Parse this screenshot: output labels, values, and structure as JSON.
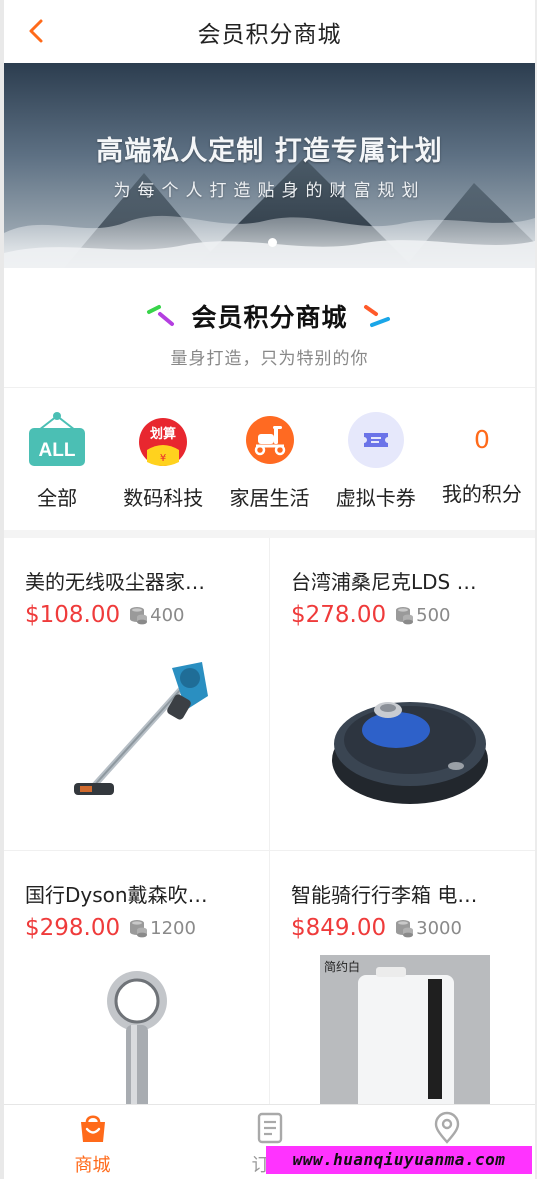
{
  "header": {
    "title": "会员积分商城"
  },
  "banner": {
    "title": "高端私人定制 打造专属计划",
    "subtitle": "为每个人打造贴身的财富规划"
  },
  "section": {
    "title": "会员积分商城",
    "subtitle": "量身打造，只为特别的你"
  },
  "categories": [
    {
      "label": "全部",
      "icon": "all-icon",
      "badge": "ALL"
    },
    {
      "label": "数码科技",
      "icon": "deal-icon",
      "badge": "划算"
    },
    {
      "label": "家居生活",
      "icon": "scooter-icon"
    },
    {
      "label": "虚拟卡券",
      "icon": "ticket-icon"
    },
    {
      "label": "我的积分",
      "value": "0"
    }
  ],
  "products": [
    {
      "name": "美的无线吸尘器家…",
      "price": "$108.00",
      "points": "400",
      "image": "vacuum"
    },
    {
      "name": "台湾浦桑尼克LDS …",
      "price": "$278.00",
      "points": "500",
      "image": "robot-vacuum"
    },
    {
      "name": "国行Dyson戴森吹…",
      "price": "$298.00",
      "points": "1200",
      "image": "hair-dryer"
    },
    {
      "name": "智能骑行行李箱 电…",
      "price": "$849.00",
      "points": "3000",
      "image": "luggage",
      "image_caption": "简约白"
    }
  ],
  "tabbar": [
    {
      "label": "商城",
      "icon": "shopping-bag-icon",
      "active": true
    },
    {
      "label": "订单",
      "icon": "order-icon",
      "active": false
    },
    {
      "label": "",
      "icon": "location-icon",
      "active": false
    }
  ],
  "watermark": "www.huanqiuyuanma.com",
  "colors": {
    "accent": "#ff6a1a",
    "price": "#ef3b3b"
  }
}
